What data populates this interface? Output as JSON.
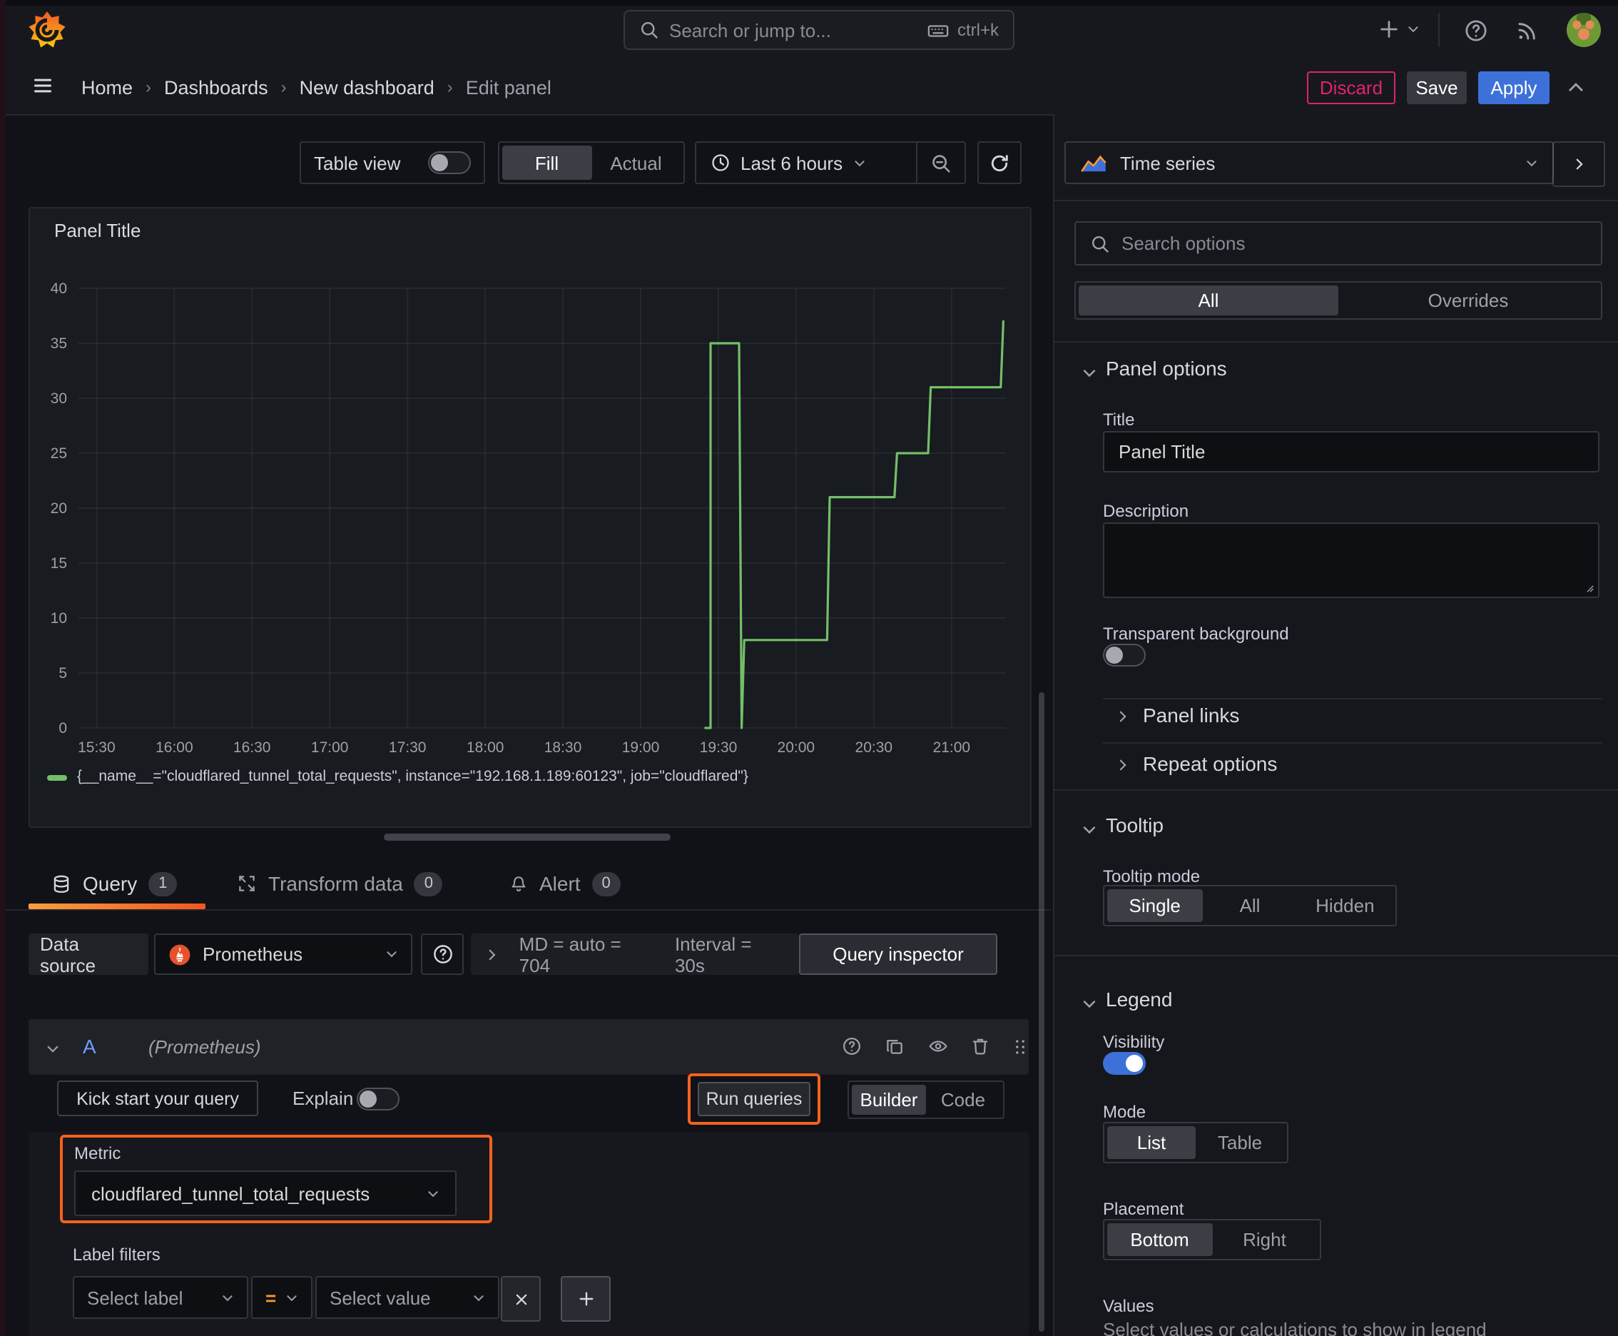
{
  "colors": {
    "accent_orange": "#f4621d",
    "series_green": "#73bf69",
    "primary_blue": "#3d71d9",
    "danger_pink": "#e0226e"
  },
  "topbar": {
    "search_placeholder": "Search or jump to...",
    "search_shortcut": "ctrl+k"
  },
  "breadcrumb": {
    "items": [
      "Home",
      "Dashboards",
      "New dashboard",
      "Edit panel"
    ]
  },
  "actions": {
    "discard": "Discard",
    "save": "Save",
    "apply": "Apply"
  },
  "toolbar": {
    "table_view_label": "Table view",
    "fill": "Fill",
    "actual": "Actual",
    "time_range": "Last 6 hours"
  },
  "panel": {
    "title": "Panel Title",
    "legend_label": "{__name__=\"cloudflared_tunnel_total_requests\", instance=\"192.168.1.189:60123\", job=\"cloudflared\"}"
  },
  "chart_data": {
    "type": "line",
    "title": "Panel Title",
    "x_range": [
      "15:23",
      "21:21"
    ],
    "ylim": [
      0,
      40
    ],
    "y_ticks": [
      0,
      5,
      10,
      15,
      20,
      25,
      30,
      35,
      40
    ],
    "x_ticks": [
      "15:30",
      "16:00",
      "16:30",
      "17:00",
      "17:30",
      "18:00",
      "18:30",
      "19:00",
      "19:30",
      "20:00",
      "20:30",
      "21:00"
    ],
    "grid": true,
    "legend_position": "bottom",
    "series": [
      {
        "name": "{__name__=\"cloudflared_tunnel_total_requests\", instance=\"192.168.1.189:60123\", job=\"cloudflared\"}",
        "color": "#73bf69",
        "points": [
          [
            "19:25",
            0
          ],
          [
            "19:27",
            0
          ],
          [
            "19:27",
            35
          ],
          [
            "19:38",
            35
          ],
          [
            "19:39",
            0
          ],
          [
            "19:40",
            8
          ],
          [
            "20:12",
            8
          ],
          [
            "20:13",
            21
          ],
          [
            "20:38",
            21
          ],
          [
            "20:39",
            25
          ],
          [
            "20:51",
            25
          ],
          [
            "20:52",
            31
          ],
          [
            "21:19",
            31
          ],
          [
            "21:20",
            37
          ]
        ]
      }
    ]
  },
  "tabs": {
    "query_label": "Query",
    "query_count": "1",
    "transform_label": "Transform data",
    "transform_count": "0",
    "alert_label": "Alert",
    "alert_count": "0"
  },
  "datasource": {
    "label": "Data source",
    "name": "Prometheus",
    "options_md": "MD = auto = 704",
    "options_interval": "Interval = 30s",
    "query_inspector": "Query inspector"
  },
  "query": {
    "ref_id": "A",
    "ds_hint": "(Prometheus)",
    "kick_start": "Kick start your query",
    "explain_label": "Explain",
    "run_queries": "Run queries",
    "builder": "Builder",
    "code": "Code",
    "metric_label": "Metric",
    "metric_value": "cloudflared_tunnel_total_requests",
    "label_filters_label": "Label filters",
    "select_label_placeholder": "Select label",
    "operator": "=",
    "select_value_placeholder": "Select value"
  },
  "sidebar": {
    "viz_name": "Time series",
    "search_placeholder": "Search options",
    "tab_all": "All",
    "tab_overrides": "Overrides",
    "panel_options": {
      "header": "Panel options",
      "title_label": "Title",
      "title_value": "Panel Title",
      "description_label": "Description",
      "transparent_label": "Transparent background"
    },
    "panel_links": "Panel links",
    "repeat_options": "Repeat options",
    "tooltip": {
      "header": "Tooltip",
      "mode_label": "Tooltip mode",
      "options": [
        "Single",
        "All",
        "Hidden"
      ]
    },
    "legend": {
      "header": "Legend",
      "visibility_label": "Visibility",
      "mode_label": "Mode",
      "mode_options": [
        "List",
        "Table"
      ],
      "placement_label": "Placement",
      "placement_options": [
        "Bottom",
        "Right"
      ],
      "values_label": "Values",
      "values_desc": "Select values or calculations to show in legend"
    }
  }
}
